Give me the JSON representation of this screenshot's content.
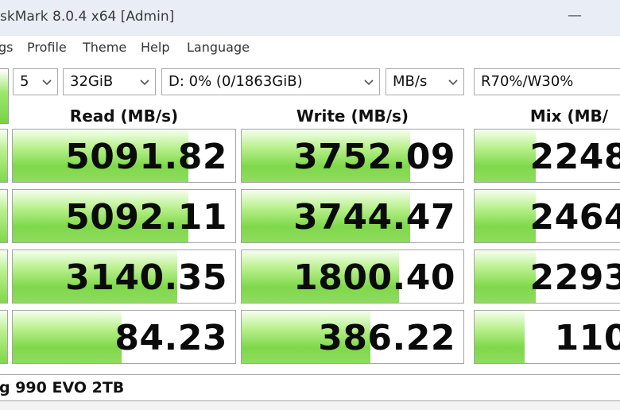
{
  "window": {
    "title": "skMark 8.0.4 x64 [Admin]",
    "minimize_glyph": "—"
  },
  "menu": {
    "items": [
      "gs",
      "Profile",
      "Theme",
      "Help",
      "Language"
    ]
  },
  "controls": {
    "count": "5",
    "size": "32GiB",
    "drive": "D: 0% (0/1863GiB)",
    "unit": "MB/s",
    "mix": "R70%/W30%"
  },
  "columns": {
    "read": "Read (MB/s)",
    "write": "Write (MB/s)",
    "mix": "Mix (MB/"
  },
  "results": [
    {
      "read": "5091.82",
      "write": "3752.09",
      "mix": "2248",
      "read_fill": 0.79,
      "write_fill": 0.76,
      "mix_fill": 0.4
    },
    {
      "read": "5092.11",
      "write": "3744.47",
      "mix": "2464",
      "read_fill": 0.79,
      "write_fill": 0.76,
      "mix_fill": 0.4
    },
    {
      "read": "3140.35",
      "write": "1800.40",
      "mix": "2293",
      "read_fill": 0.74,
      "write_fill": 0.71,
      "mix_fill": 0.4
    },
    {
      "read": "84.23",
      "write": "386.22",
      "mix": "110",
      "read_fill": 0.49,
      "write_fill": 0.58,
      "mix_fill": 0.33
    }
  ],
  "status": {
    "device": "g 990 EVO 2TB"
  },
  "colors": {
    "accent_green": "#7fd84a",
    "title_bg": "#e9eef6"
  }
}
